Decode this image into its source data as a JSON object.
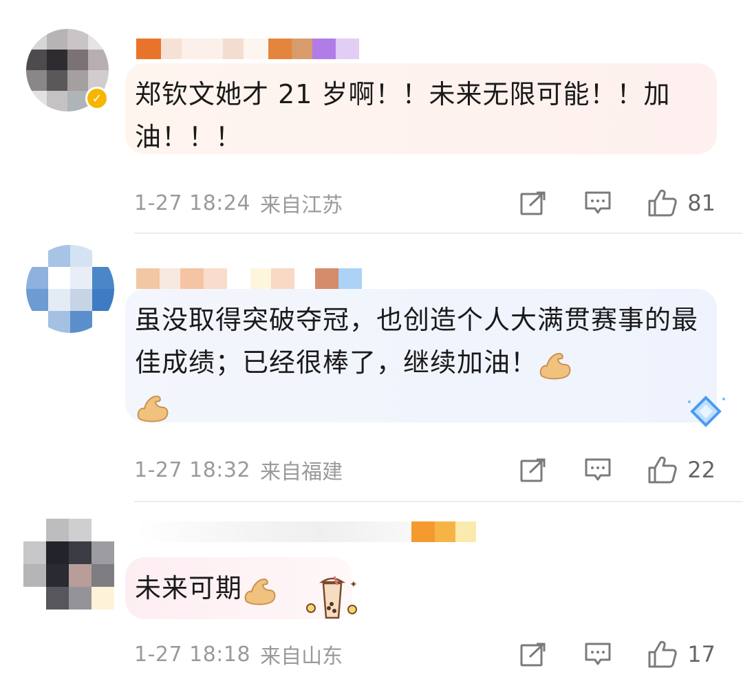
{
  "comments": [
    {
      "text": "郑钦文她才 21 岁啊！！未来无限可能！！加油！！！",
      "time": "1-27 18:24",
      "location": "来自江苏",
      "likes": "81",
      "verified": true,
      "bubble_gradient": [
        "#fff3ec",
        "#fdf2f0"
      ]
    },
    {
      "text": "虽没取得突破夺冠，也创造个人大满贯赛事的最佳成绩；已经很棒了，继续加油！",
      "time": "1-27 18:32",
      "location": "来自福建",
      "likes": "22",
      "verified": false,
      "bubble_gradient": [
        "#f1f6ff",
        "#f3f5fb"
      ]
    },
    {
      "text": "未来可期",
      "time": "1-27 18:18",
      "location": "来自山东",
      "likes": "17",
      "verified": false,
      "bubble_gradient": [
        "#fdf0f3",
        "#ffffff"
      ]
    }
  ],
  "icons": {
    "share": "share-icon",
    "comment": "comment-icon",
    "like": "thumbs-up-icon",
    "flex": "flexed-biceps-emoji",
    "bubble_tea": "bubble-tea-sticker",
    "diamond": "diamond-badge-icon",
    "verified": "verified-badge-icon"
  },
  "colors": {
    "meta_text": "#9a9a9a",
    "verified_badge": "#f7b500",
    "divider": "#ececec"
  }
}
